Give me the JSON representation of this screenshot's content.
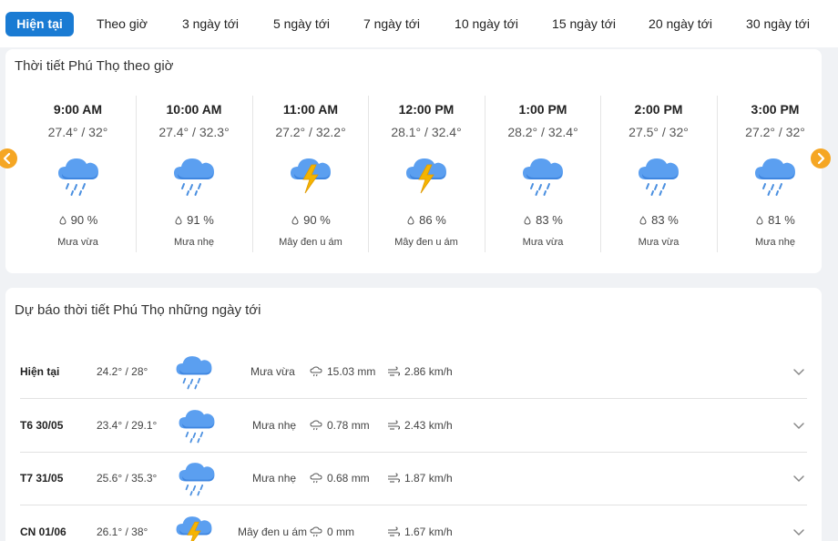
{
  "tabs": [
    {
      "label": "Hiện tại",
      "active": true
    },
    {
      "label": "Theo giờ"
    },
    {
      "label": "3 ngày tới"
    },
    {
      "label": "5 ngày tới"
    },
    {
      "label": "7 ngày tới"
    },
    {
      "label": "10 ngày tới"
    },
    {
      "label": "15 ngày tới"
    },
    {
      "label": "20 ngày tới"
    },
    {
      "label": "30 ngày tới"
    }
  ],
  "hourly": {
    "title": "Thời tiết Phú Thọ theo giờ",
    "items": [
      {
        "time": "9:00 AM",
        "temp": "27.4° / 32°",
        "icon": "rain-cloud-icon",
        "humidity": "90 %",
        "desc": "Mưa vừa"
      },
      {
        "time": "10:00 AM",
        "temp": "27.4° / 32.3°",
        "icon": "rain-cloud-icon",
        "humidity": "91 %",
        "desc": "Mưa nhẹ"
      },
      {
        "time": "11:00 AM",
        "temp": "27.2° / 32.2°",
        "icon": "thunder-cloud-icon",
        "humidity": "90 %",
        "desc": "Mây đen u ám"
      },
      {
        "time": "12:00 PM",
        "temp": "28.1° / 32.4°",
        "icon": "thunder-cloud-icon",
        "humidity": "86 %",
        "desc": "Mây đen u ám"
      },
      {
        "time": "1:00 PM",
        "temp": "28.2° / 32.4°",
        "icon": "rain-cloud-icon",
        "humidity": "83 %",
        "desc": "Mưa vừa"
      },
      {
        "time": "2:00 PM",
        "temp": "27.5° / 32°",
        "icon": "rain-cloud-icon",
        "humidity": "83 %",
        "desc": "Mưa vừa"
      },
      {
        "time": "3:00 PM",
        "temp": "27.2° / 32°",
        "icon": "rain-cloud-icon",
        "humidity": "81 %",
        "desc": "Mưa nhẹ"
      }
    ]
  },
  "daily": {
    "title": "Dự báo thời tiết Phú Thọ những ngày tới",
    "rows": [
      {
        "day": "Hiện tại",
        "temp": "24.2° / 28°",
        "icon": "rain-cloud-icon",
        "desc": "Mưa vừa",
        "rain": "15.03 mm",
        "wind": "2.86 km/h"
      },
      {
        "day": "T6 30/05",
        "temp": "23.4° / 29.1°",
        "icon": "rain-cloud-icon",
        "desc": "Mưa nhẹ",
        "rain": "0.78 mm",
        "wind": "2.43 km/h"
      },
      {
        "day": "T7 31/05",
        "temp": "25.6° / 35.3°",
        "icon": "rain-cloud-icon",
        "desc": "Mưa nhẹ",
        "rain": "0.68 mm",
        "wind": "1.87 km/h"
      },
      {
        "day": "CN 01/06",
        "temp": "26.1° / 38°",
        "icon": "thunder-cloud-icon",
        "desc": "Mây đen u ám",
        "rain": "0 mm",
        "wind": "1.67 km/h"
      }
    ]
  },
  "colors": {
    "accent": "#1a7bd3",
    "nav": "#f5a623",
    "cloud": "#5b9ff0",
    "bolt": "#f5b400",
    "rain": "#4a8fe0"
  }
}
